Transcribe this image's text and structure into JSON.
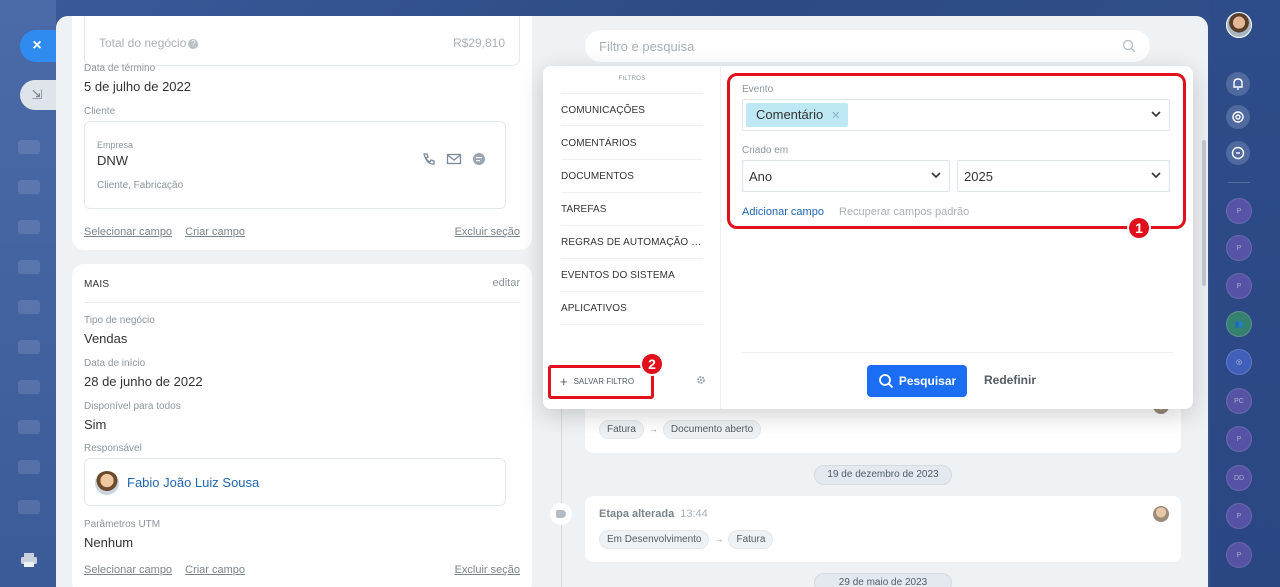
{
  "left_rail": {
    "close_label": "×",
    "collapse_label": "⇲"
  },
  "deal_panel": {
    "total_label": "Total do negócio",
    "total_value": "R$29,810",
    "end_date_label": "Data de término",
    "end_date_value": "5 de julho de 2022",
    "client_label": "Cliente",
    "company_label": "Empresa",
    "company_name": "DNW",
    "company_sub": "Cliente, Fabricação",
    "select_field": "Selecionar campo",
    "create_field": "Criar campo",
    "delete_section": "Excluir seção"
  },
  "mais_panel": {
    "title": "MAIS",
    "edit": "editar",
    "deal_type_label": "Tipo de negócio",
    "deal_type_value": "Vendas",
    "start_date_label": "Data de início",
    "start_date_value": "28 de junho de 2022",
    "available_label": "Disponível para todos",
    "available_value": "Sim",
    "responsible_label": "Responsável",
    "responsible_name": "Fabio João Luiz Sousa",
    "utm_label": "Parâmetros UTM",
    "utm_value": "Nenhum",
    "select_field": "Selecionar campo",
    "create_field": "Criar campo",
    "delete_section": "Excluir seção"
  },
  "timeline": {
    "search_placeholder": "Filtro e pesquisa",
    "card1_chips": [
      "Fatura",
      "Documento aberto"
    ],
    "date1": "19 de dezembro de 2023",
    "card2_title": "Etapa alterada",
    "card2_time": "13:44",
    "card2_chips": [
      "Em Desenvolvimento",
      "Fatura"
    ],
    "date2": "29 de maio de 2023"
  },
  "filter": {
    "heading": "FILTROS",
    "items": [
      "COMUNICAÇÕES",
      "COMENTÁRIOS",
      "DOCUMENTOS",
      "TAREFAS",
      "REGRAS DE AUTOMAÇÃO E F...",
      "EVENTOS DO SISTEMA",
      "APLICATIVOS"
    ],
    "save_filter": "SALVAR FILTRO",
    "event_label": "Evento",
    "event_tag": "Comentário",
    "created_label": "Criado em",
    "created_period": "Ano",
    "created_year": "2025",
    "add_field": "Adicionar campo",
    "restore_fields": "Recuperar campos padrão",
    "search_button": "Pesquisar",
    "reset_button": "Redefinir"
  },
  "annotations": {
    "badge1": "1",
    "badge2": "2",
    "accent_color": "#e0101c"
  },
  "right_rail": {
    "bubbles": [
      "P",
      "P",
      "P",
      "",
      "",
      "PC",
      "P",
      "DD",
      "P",
      "P"
    ]
  }
}
